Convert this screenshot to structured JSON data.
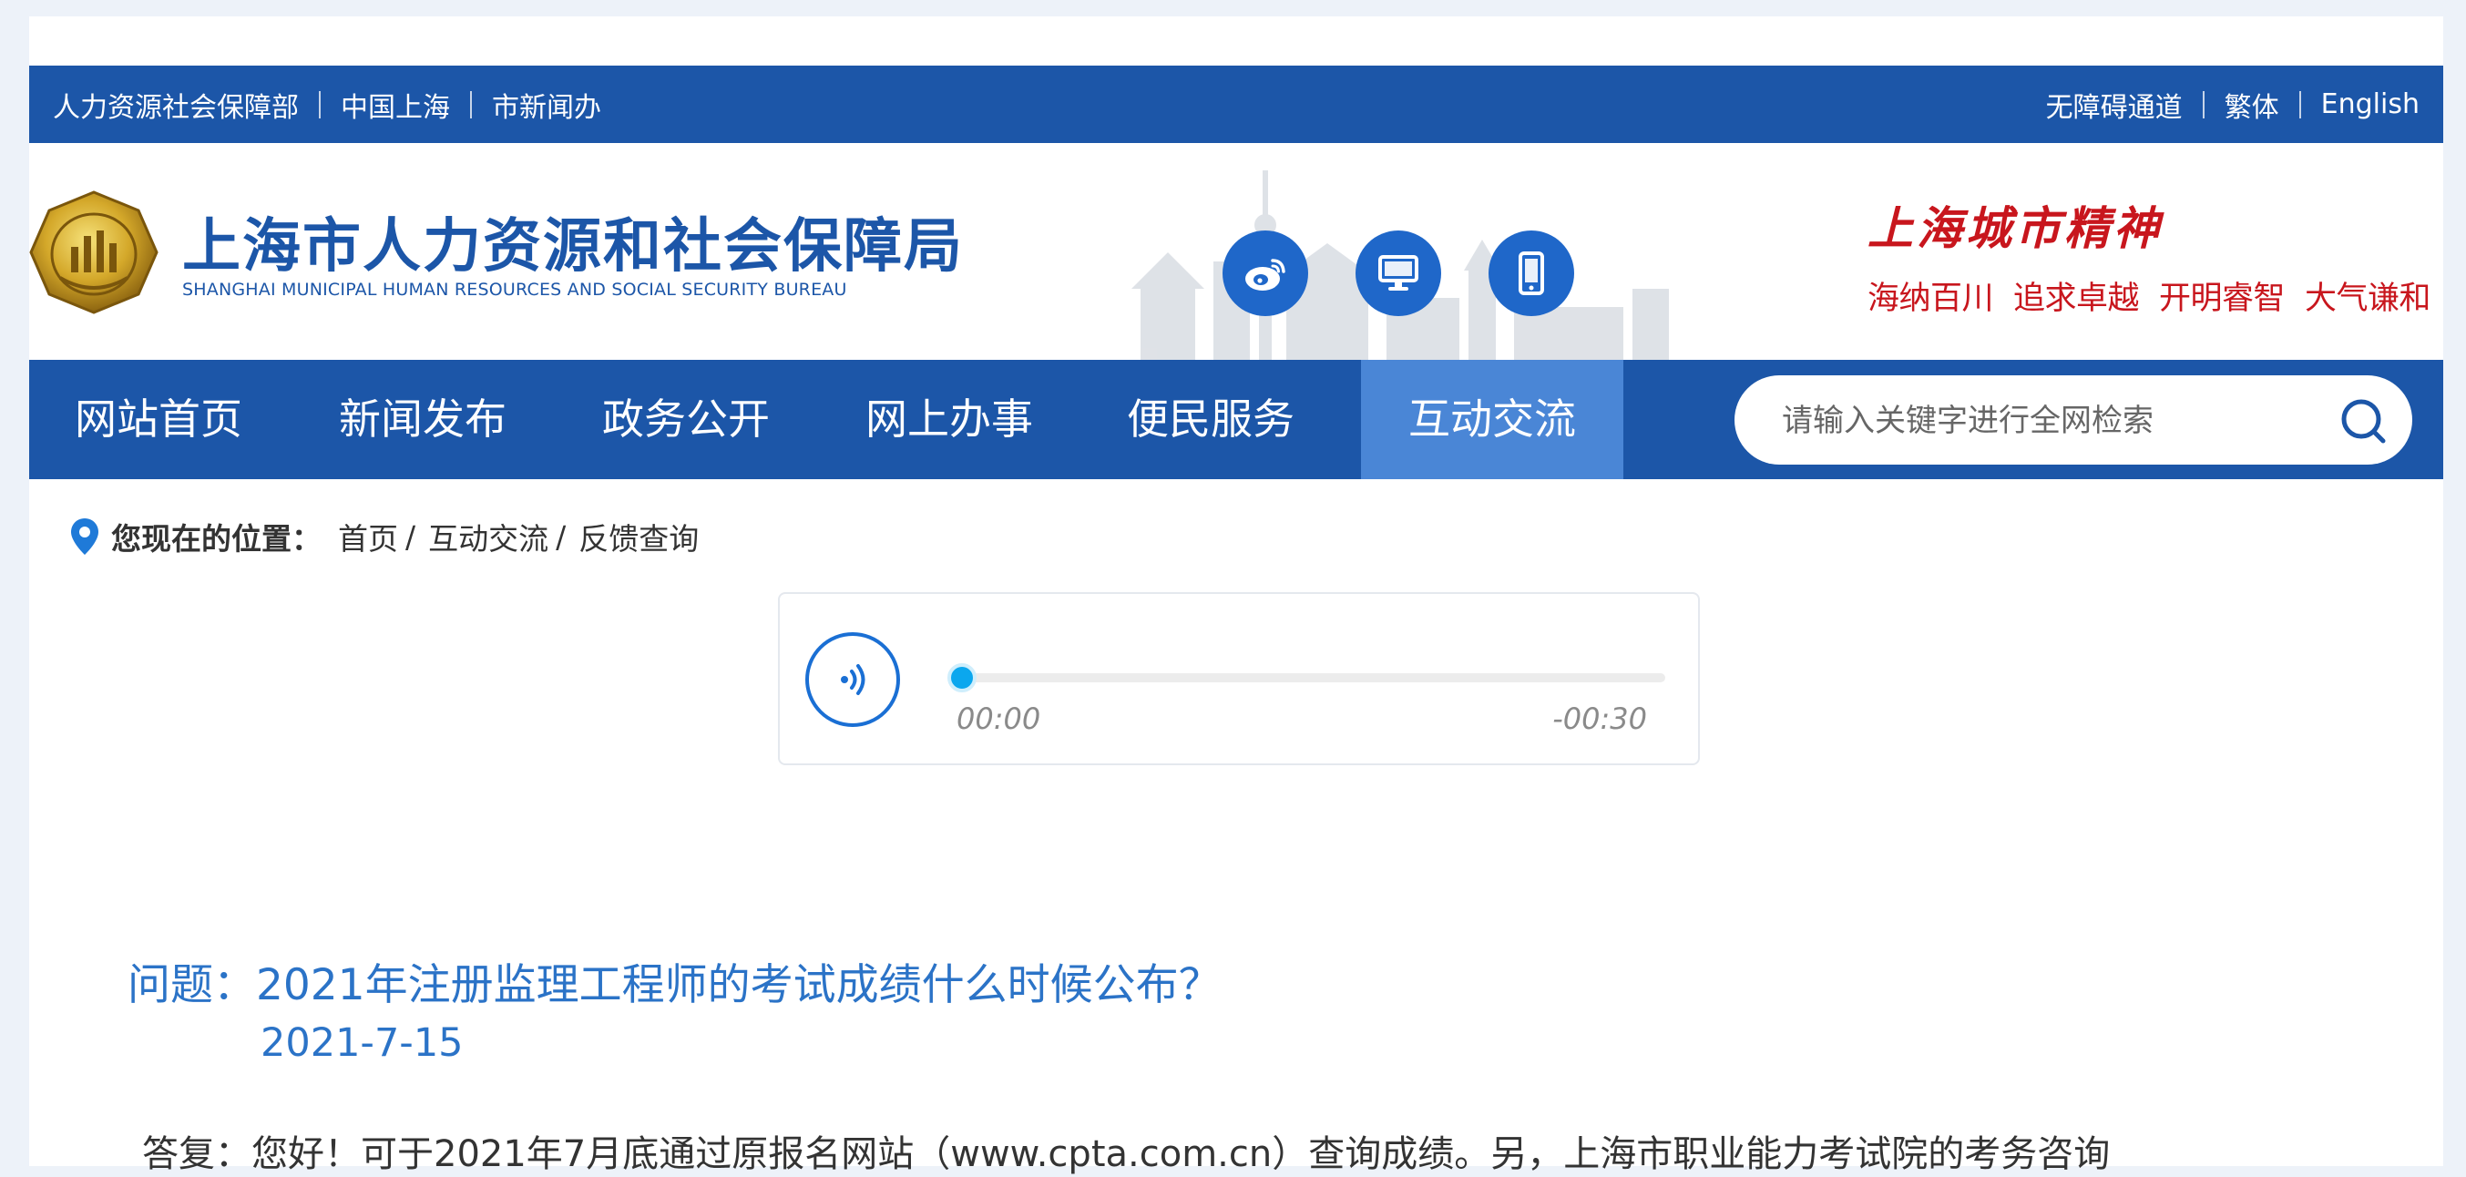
{
  "topbar": {
    "left_links": [
      "人力资源社会保障部",
      "中国上海",
      "市新闻办"
    ],
    "right_links": [
      "无障碍通道",
      "繁体",
      "English"
    ]
  },
  "header": {
    "title_cn": "上海市人力资源和社会保障局",
    "title_en": "SHANGHAI MUNICIPAL HUMAN RESOURCES AND SOCIAL SECURITY BUREAU",
    "icons": [
      "weibo-icon",
      "desktop-icon",
      "mobile-icon"
    ],
    "spirit_title": "上海城市精神",
    "spirit_words": [
      "海纳百川",
      "追求卓越",
      "开明睿智",
      "大气谦和"
    ]
  },
  "nav": {
    "items": [
      {
        "label": "网站首页",
        "active": false
      },
      {
        "label": "新闻发布",
        "active": false
      },
      {
        "label": "政务公开",
        "active": false
      },
      {
        "label": "网上办事",
        "active": false
      },
      {
        "label": "便民服务",
        "active": false
      },
      {
        "label": "互动交流",
        "active": true
      }
    ],
    "search_placeholder": "请输入关键字进行全网检索"
  },
  "breadcrumb": {
    "label": "您现在的位置：",
    "items": [
      "首页",
      "互动交流",
      "反馈查询"
    ]
  },
  "player": {
    "current_time": "00:00",
    "remaining_time": "-00:30",
    "progress": 0
  },
  "question": {
    "title": "问题：2021年注册监理工程师的考试成绩什么时候公布？",
    "date": "2021-7-15"
  },
  "answer": {
    "text": "答复：您好！可于2021年7月底通过原报名网站（www.cpta.com.cn）查询成绩。另，上海市职业能力考试院的考务咨询"
  },
  "colors": {
    "primary_blue": "#1c56a8",
    "active_nav": "#4a86d6",
    "spirit_red": "#c8161d",
    "question_blue": "#2b73c7"
  }
}
